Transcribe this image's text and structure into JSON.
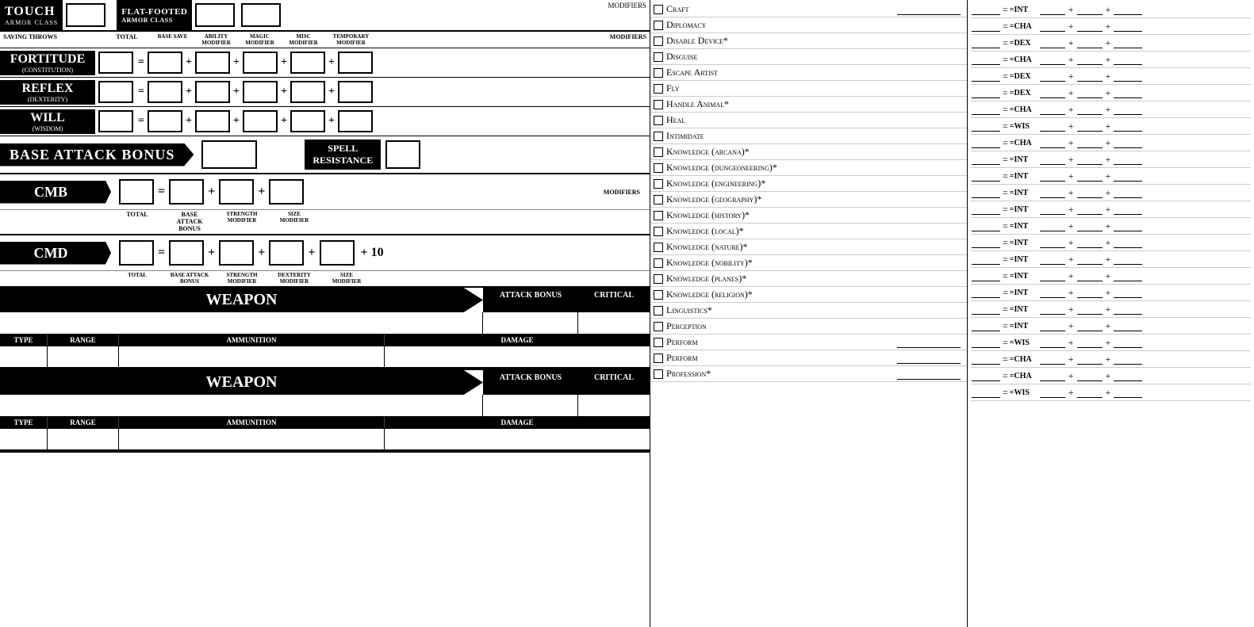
{
  "top": {
    "touch_label": "TOUCH",
    "touch_sub": "ARMOR CLASS",
    "flat_footed_label": "FLAT-FOOTED",
    "flat_footed_sub": "ARMOR CLASS",
    "modifiers": "MODIFIERS"
  },
  "saving_throws": {
    "header": {
      "label": "SAVING THROWS",
      "total": "TOTAL",
      "base_save": "BASE SAVE",
      "ability_mod": "ABILITY MODIFIER",
      "magic_mod": "MAGIC MODIFIER",
      "misc_mod": "MISC MODIFIER",
      "temp_mod": "TEMPORARY MODIFIER",
      "modifiers": "MODIFIERS"
    },
    "rows": [
      {
        "name": "FORTITUDE",
        "sub": "(CONSTITUTION)"
      },
      {
        "name": "REFLEX",
        "sub": "(DEXTERITY)"
      },
      {
        "name": "WILL",
        "sub": "(WISDOM)"
      }
    ]
  },
  "bab": {
    "label": "BASE ATTACK BONUS",
    "spell_resistance": "SPELL\nRESISTANCE"
  },
  "cmb": {
    "label": "CMB",
    "total_lbl": "TOTAL",
    "bab_lbl": "BASE ATTACK\nBONUS",
    "str_lbl": "STRENGTH\nMODIFIER",
    "size_lbl": "SIZE\nMODIFIER",
    "modifiers": "MODIFIERS"
  },
  "cmd": {
    "label": "CMD",
    "total_lbl": "TOTAL",
    "bab_lbl": "BASE ATTACK\nBONUS",
    "str_lbl": "STRENGTH\nMODIFIER",
    "dex_lbl": "DEXTERITY\nMODIFIER",
    "size_lbl": "SIZE\nMODIFIER",
    "plus10": "+ 10"
  },
  "weapons": [
    {
      "title": "WEAPON",
      "attack_bonus_col": "ATTACK BONUS",
      "critical_col": "CRITICAL",
      "type_col": "TYPE",
      "range_col": "RANGE",
      "ammo_col": "AMMUNITION",
      "damage_col": "DAMAGE"
    },
    {
      "title": "WEAPON",
      "attack_bonus_col": "ATTACK BONUS",
      "critical_col": "CRITICAL",
      "type_col": "TYPE",
      "range_col": "RANGE",
      "ammo_col": "AMMUNITION",
      "damage_col": "DAMAGE"
    }
  ],
  "skills": [
    {
      "name": "Craft",
      "trained": false,
      "ability": ""
    },
    {
      "name": "Diplomacy",
      "trained": false,
      "ability": ""
    },
    {
      "name": "Disable Device*",
      "trained": false,
      "ability": ""
    },
    {
      "name": "Disguise",
      "trained": false,
      "ability": ""
    },
    {
      "name": "Escape Artist",
      "trained": false,
      "ability": ""
    },
    {
      "name": "Fly",
      "trained": false,
      "ability": ""
    },
    {
      "name": "Handle Animal*",
      "trained": false,
      "ability": ""
    },
    {
      "name": "Heal",
      "trained": false,
      "ability": ""
    },
    {
      "name": "Intimidate",
      "trained": false,
      "ability": ""
    },
    {
      "name": "Knowledge (arcana)*",
      "trained": false,
      "ability": ""
    },
    {
      "name": "Knowledge (dungeoneering)*",
      "trained": false,
      "ability": ""
    },
    {
      "name": "Knowledge (engineering)*",
      "trained": false,
      "ability": ""
    },
    {
      "name": "Knowledge (geography)*",
      "trained": false,
      "ability": ""
    },
    {
      "name": "Knowledge (history)*",
      "trained": false,
      "ability": ""
    },
    {
      "name": "Knowledge (local)*",
      "trained": false,
      "ability": ""
    },
    {
      "name": "Knowledge (nature)*",
      "trained": false,
      "ability": ""
    },
    {
      "name": "Knowledge (nobility)*",
      "trained": false,
      "ability": ""
    },
    {
      "name": "Knowledge (planes)*",
      "trained": false,
      "ability": ""
    },
    {
      "name": "Knowledge (religion)*",
      "trained": false,
      "ability": ""
    },
    {
      "name": "Linguistics*",
      "trained": false,
      "ability": ""
    },
    {
      "name": "Perception",
      "trained": false,
      "ability": ""
    },
    {
      "name": "Perform",
      "trained": false,
      "ability": ""
    },
    {
      "name": "Perform",
      "trained": false,
      "ability": ""
    },
    {
      "name": "Profession*",
      "trained": false,
      "ability": ""
    }
  ],
  "right_skills_abilities": [
    "=INT",
    "=CHA",
    "=DEX",
    "=CHA",
    "=DEX",
    "=DEX",
    "=CHA",
    "=WIS",
    "=CHA",
    "=INT",
    "=INT",
    "=INT",
    "=INT",
    "=INT",
    "=INT",
    "=INT",
    "=INT",
    "=INT",
    "=INT",
    "=INT",
    "=WIS",
    "=CHA",
    "=CHA",
    "=WIS"
  ]
}
